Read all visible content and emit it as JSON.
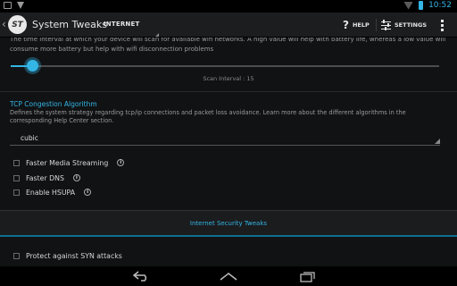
{
  "status_bar": {
    "time": "10:52"
  },
  "action_bar": {
    "app_title": "System Tweaks",
    "current_tab": "INTERNET",
    "help_label": "HELP",
    "settings_label": "SETTINGS"
  },
  "content": {
    "scan_description": "The time interval at which your device will scan for available wifi networks. A high value will help with battery life, whereas a low value will consume more battery but help with wifi disconnection problems",
    "scan_interval_label": "Scan Interval : 15",
    "scan_interval_value": 15,
    "tcp_section": {
      "title": "TCP Congestion Algorithm",
      "description": "Defines the system strategy regarding tcp/ip connections and packet loss avoidance. Learn more about the different algorithms in the corresponding Help Center section.",
      "selected": "cubic"
    },
    "checkboxes": [
      {
        "label": "Faster Media Streaming",
        "checked": false
      },
      {
        "label": "Faster DNS",
        "checked": false
      },
      {
        "label": "Enable HSUPA",
        "checked": false
      }
    ],
    "security_header": "Internet Security Tweaks",
    "security_checkboxes": [
      {
        "label": "Protect against SYN attacks",
        "checked": false
      }
    ]
  },
  "colors": {
    "accent": "#33b5e5",
    "background": "#111214"
  }
}
